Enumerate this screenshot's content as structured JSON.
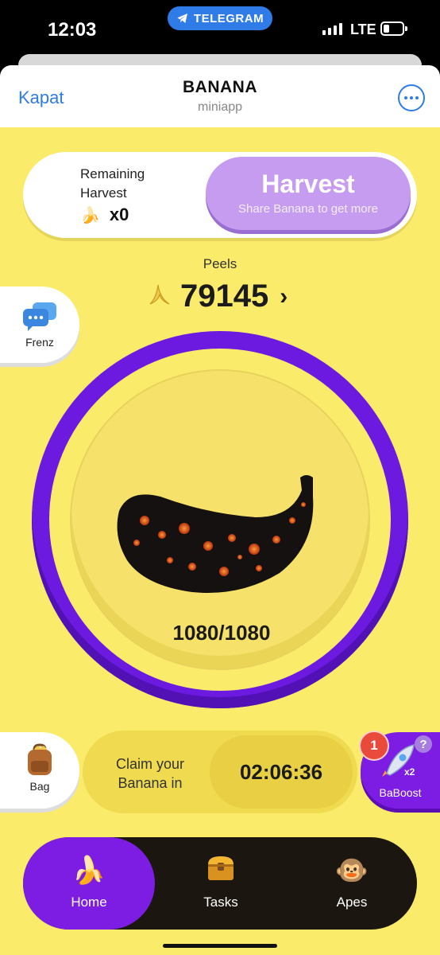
{
  "status_bar": {
    "time": "12:03",
    "app_pill": "TELEGRAM",
    "network": "LTE"
  },
  "header": {
    "close_label": "Kapat",
    "title": "BANANA",
    "subtitle": "miniapp"
  },
  "harvest": {
    "remaining_label": "Remaining Harvest",
    "remaining_count": "x0",
    "button_title": "Harvest",
    "button_subtitle": "Share Banana to get more"
  },
  "peels": {
    "label": "Peels",
    "value": "79145"
  },
  "side_buttons": {
    "frenz_label": "Frenz",
    "bag_label": "Bag",
    "boost_label": "BaBoost",
    "boost_badge": "1",
    "boost_multiplier": "x2",
    "help_mark": "?"
  },
  "tap": {
    "energy": "1080/1080"
  },
  "claim": {
    "label": "Claim your Banana in",
    "timer": "02:06:36"
  },
  "nav": {
    "home": "Home",
    "tasks": "Tasks",
    "apes": "Apes",
    "active": "Home"
  },
  "colors": {
    "background": "#fbeb6b",
    "accent_purple": "#7d1de4",
    "harvest_button": "#c69cf0",
    "telegram_blue": "#2f7ce8",
    "nav_dark": "#1b1610"
  },
  "icons": {
    "banana": "banana-icon",
    "peel": "banana-peel-icon",
    "chat": "chat-bubbles-icon",
    "bag": "backpack-icon",
    "rocket": "rocket-icon",
    "tasks": "treasure-chest-icon",
    "apes": "monkeys-icon"
  }
}
